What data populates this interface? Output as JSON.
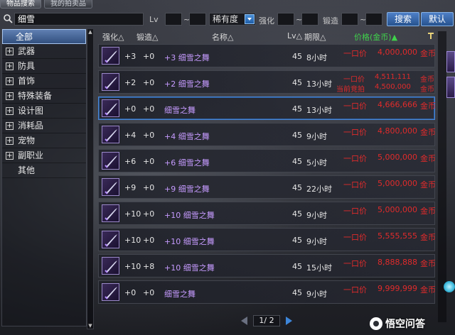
{
  "tabs": [
    "物品搜索",
    "我的拍卖品"
  ],
  "search": {
    "keyword": "细雪",
    "lv_label": "Lv",
    "tilde": "~",
    "rarity": "稀有度",
    "enhance_label": "强化",
    "forge_label": "锻造",
    "search_button": "搜索",
    "default_button": "默认"
  },
  "categories": [
    {
      "label": "全部",
      "type": "all"
    },
    {
      "label": "武器",
      "type": "plus"
    },
    {
      "label": "防具",
      "type": "plus"
    },
    {
      "label": "首饰",
      "type": "plus"
    },
    {
      "label": "特殊装备",
      "type": "plus"
    },
    {
      "label": "设计图",
      "type": "plus"
    },
    {
      "label": "消耗品",
      "type": "plus"
    },
    {
      "label": "宠物",
      "type": "plus"
    },
    {
      "label": "副职业",
      "type": "plus"
    },
    {
      "label": "其他",
      "type": "plain"
    }
  ],
  "header": {
    "enhance": "强化△",
    "forge": "锻造△",
    "name": "名称△",
    "lv": "Lv△",
    "period": "期限△",
    "price": "价格(金币)▲"
  },
  "rows": [
    {
      "enh": "+3",
      "forge": "+0",
      "name": "+3 细雪之舞",
      "lv": "45",
      "time": "8小时",
      "mode": "一口价",
      "price": "4,000,000",
      "unit": "金币"
    },
    {
      "enh": "+2",
      "forge": "+0",
      "name": "+2 细雪之舞",
      "lv": "45",
      "time": "13小时",
      "mode": "一口价",
      "price": "4,511,111",
      "unit": "金币",
      "mode2": "当前竞拍",
      "price2": "4,500,000",
      "unit2": "金币"
    },
    {
      "enh": "+0",
      "forge": "+0",
      "name": "细雪之舞",
      "lv": "45",
      "time": "13小时",
      "mode": "一口价",
      "price": "4,666,666",
      "unit": "金币"
    },
    {
      "enh": "+4",
      "forge": "+0",
      "name": "+4 细雪之舞",
      "lv": "45",
      "time": "9小时",
      "mode": "一口价",
      "price": "4,800,000",
      "unit": "金币"
    },
    {
      "enh": "+6",
      "forge": "+0",
      "name": "+6 细雪之舞",
      "lv": "45",
      "time": "5小时",
      "mode": "一口价",
      "price": "5,000,000",
      "unit": "金币"
    },
    {
      "enh": "+9",
      "forge": "+0",
      "name": "+9 细雪之舞",
      "lv": "45",
      "time": "22小时",
      "mode": "一口价",
      "price": "5,000,000",
      "unit": "金币"
    },
    {
      "enh": "+10",
      "forge": "+0",
      "name": "+10 细雪之舞",
      "lv": "45",
      "time": "9小时",
      "mode": "一口价",
      "price": "5,000,000",
      "unit": "金币"
    },
    {
      "enh": "+10",
      "forge": "+0",
      "name": "+10 细雪之舞",
      "lv": "45",
      "time": "9小时",
      "mode": "一口价",
      "price": "5,555,555",
      "unit": "金币"
    },
    {
      "enh": "+10",
      "forge": "+8",
      "name": "+10 细雪之舞",
      "lv": "45",
      "time": "15小时",
      "mode": "一口价",
      "price": "8,888,888",
      "unit": "金币"
    },
    {
      "enh": "+0",
      "forge": "+0",
      "name": "细雪之舞",
      "lv": "45",
      "time": "9小时",
      "mode": "一口价",
      "price": "9,999,999",
      "unit": "金币"
    }
  ],
  "pager": {
    "text": "1/ 2"
  },
  "watermark": "悟空问答",
  "colors": {
    "name": "#c69bff",
    "price": "#e02b2b",
    "price_header": "#3fd24b",
    "selected_border": "#4a86d4"
  }
}
